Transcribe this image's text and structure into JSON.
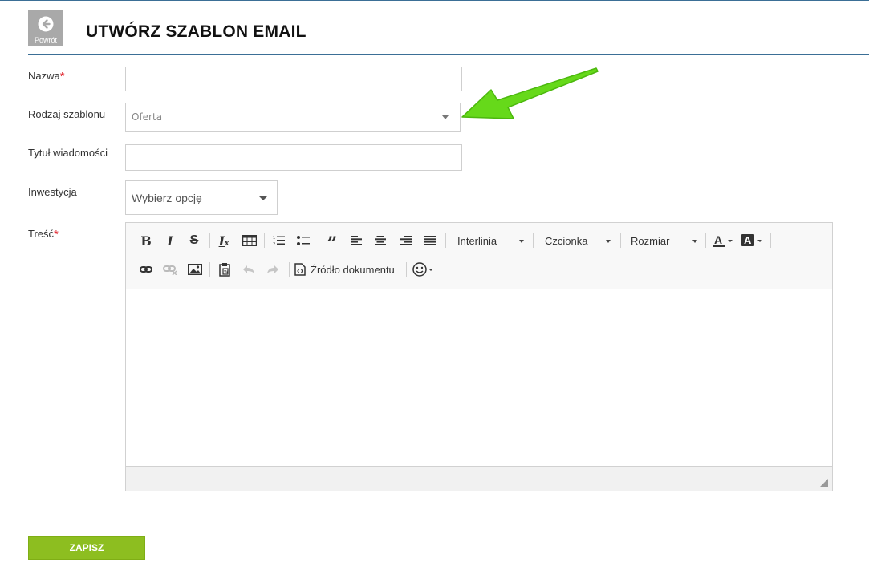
{
  "header": {
    "back_label": "Powrót",
    "title": "UTWÓRZ SZABLON EMAIL"
  },
  "form": {
    "required_mark": "*",
    "name_label": "Nazwa",
    "name_value": "",
    "template_type_label": "Rodzaj szablonu",
    "template_type_value": "Oferta",
    "subject_label": "Tytuł wiadomości",
    "subject_value": "",
    "investment_label": "Inwestycja",
    "investment_value": "Wybierz opcję",
    "content_label": "Treść"
  },
  "editor": {
    "toolbar": {
      "line_height_label": "Interlinia",
      "font_label": "Czcionka",
      "size_label": "Rozmiar",
      "source_label": "Źródło dokumentu"
    },
    "content": ""
  },
  "actions": {
    "save_label": "ZAPISZ"
  },
  "colors": {
    "accent_line": "#3b6f96",
    "required": "#e0262f",
    "save_button": "#8dbe20",
    "annotation_arrow": "#66d91a"
  }
}
